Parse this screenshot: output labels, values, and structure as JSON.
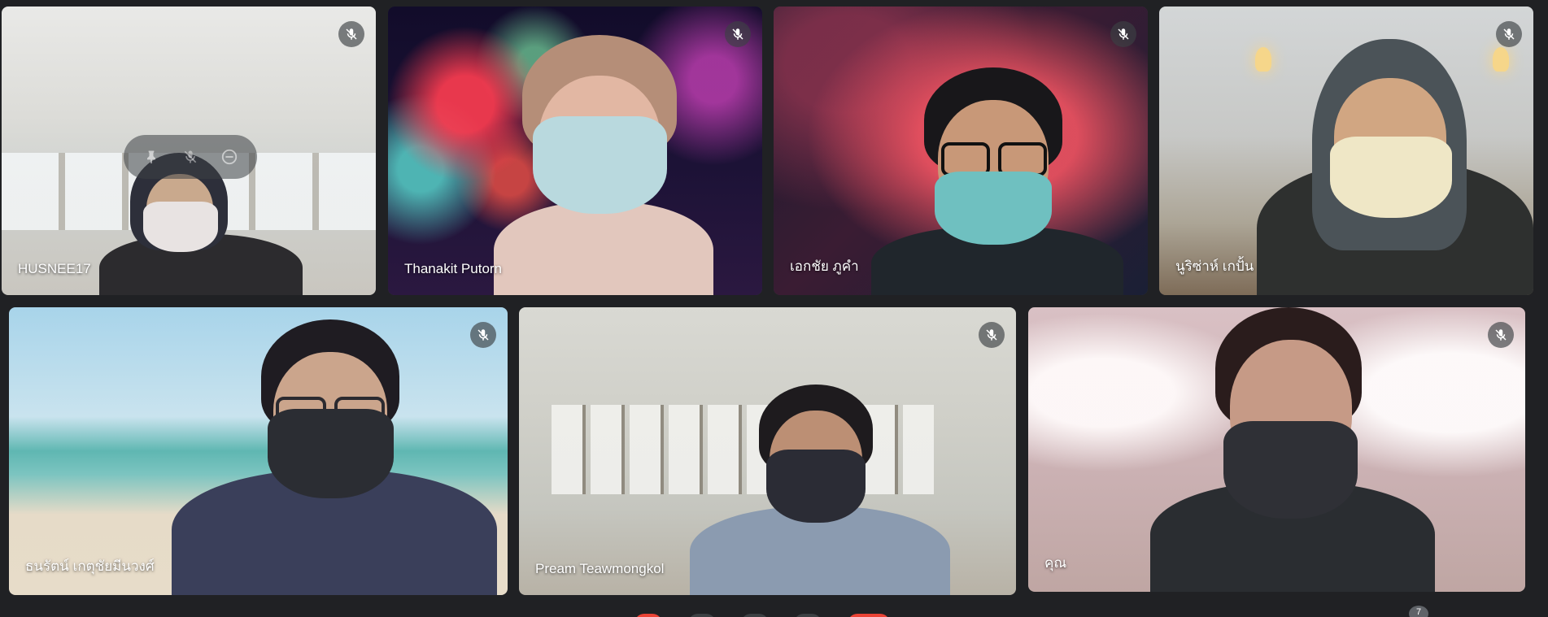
{
  "meeting": {
    "participants": [
      {
        "name": "HUSNEE17",
        "muted": true
      },
      {
        "name": "Thanakit Putorn",
        "muted": true
      },
      {
        "name": "เอกชัย ภูคำ",
        "muted": true
      },
      {
        "name": "นูริซ่าห์ เกปั้น",
        "muted": true
      },
      {
        "name": "ธนรัตน์ เกตุชัยมีนวงศ์",
        "muted": true
      },
      {
        "name": "Pream Teawmongkol",
        "muted": true
      },
      {
        "name": "คุณ",
        "muted": true
      }
    ],
    "tile_hover_controls": {
      "icons": [
        "pin-icon",
        "mic-off-icon",
        "remove-icon"
      ]
    },
    "people_count": "7"
  },
  "icons": {
    "mute": "mic-off-icon",
    "pin": "pin-icon",
    "remove": "remove-icon"
  },
  "colors": {
    "background": "#202124",
    "mute_badge": "#3c4043",
    "end_call": "#ea4335"
  }
}
